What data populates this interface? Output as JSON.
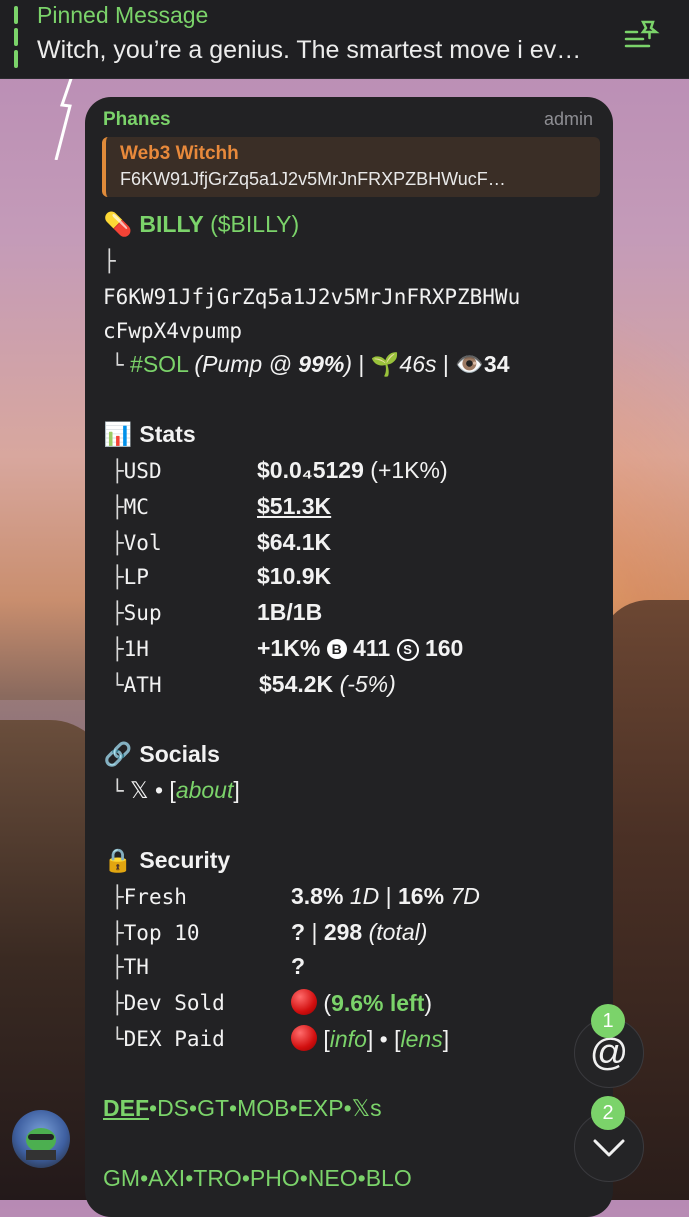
{
  "pinned": {
    "title": "Pinned Message",
    "text": "Witch, you’re a genius. The smartest move i ev…"
  },
  "message": {
    "sender": "Phanes",
    "role": "admin",
    "reply": {
      "name": "Web3 Witchh",
      "text": "F6KW91JfjGrZq5a1J2v5MrJnFRXPZBHWucF…"
    },
    "token": {
      "emoji": "💊",
      "name": "BILLY",
      "ticker": "($BILLY)",
      "address_line1": "F6KW91JfjGrZq5a1J2v5MrJnFRXPZBHWu",
      "address_line2": "cFwpX4vpump",
      "chain": "#SOL",
      "pump_label": "(Pump @ ",
      "pump_pct": "99%",
      "pump_close": ")",
      "age": "46s",
      "views": "34"
    },
    "stats": {
      "heading": "Stats",
      "rows": [
        {
          "key": "USD",
          "value": "$0.0₄5129",
          "extra": " (+1K%)"
        },
        {
          "key": "MC",
          "value": "$51.3K",
          "extra": ""
        },
        {
          "key": "Vol",
          "value": "$64.1K",
          "extra": ""
        },
        {
          "key": "LP",
          "value": "$10.9K",
          "extra": ""
        },
        {
          "key": "Sup",
          "value": "1B/1B",
          "extra": ""
        }
      ],
      "h1": {
        "key": "1H",
        "change": "+1K%",
        "buys": "411",
        "sells": "160"
      },
      "ath": {
        "key": "ATH",
        "value": "$54.2K",
        "extra": "(-5%)"
      }
    },
    "socials": {
      "heading": "Socials",
      "x": "𝕏",
      "about": "about"
    },
    "security": {
      "heading": "Security",
      "fresh": {
        "key": "Fresh",
        "v1": "3.8%",
        "p1": "1D",
        "v2": "16%",
        "p2": "7D"
      },
      "top10": {
        "key": "Top 10",
        "v1": "?",
        "v2": "298",
        "note": "(total)"
      },
      "th": {
        "key": "TH",
        "value": "?"
      },
      "dev_sold": {
        "key": "Dev Sold",
        "value": "9.6% left"
      },
      "dex_paid": {
        "key": "DEX Paid",
        "info": "info",
        "lens": "lens"
      }
    },
    "links_row1": [
      "DEF",
      "DS",
      "GT",
      "MOB",
      "EXP",
      "𝕏s"
    ],
    "links_row2": [
      "GM",
      "AXI",
      "TRO",
      "PHO",
      "NEO",
      "BLO"
    ]
  },
  "badges": {
    "mention_count": "1",
    "down_count": "2"
  },
  "colors": {
    "accent": "#7bd36a",
    "reply_accent": "#e8893b",
    "card": "#222224"
  }
}
